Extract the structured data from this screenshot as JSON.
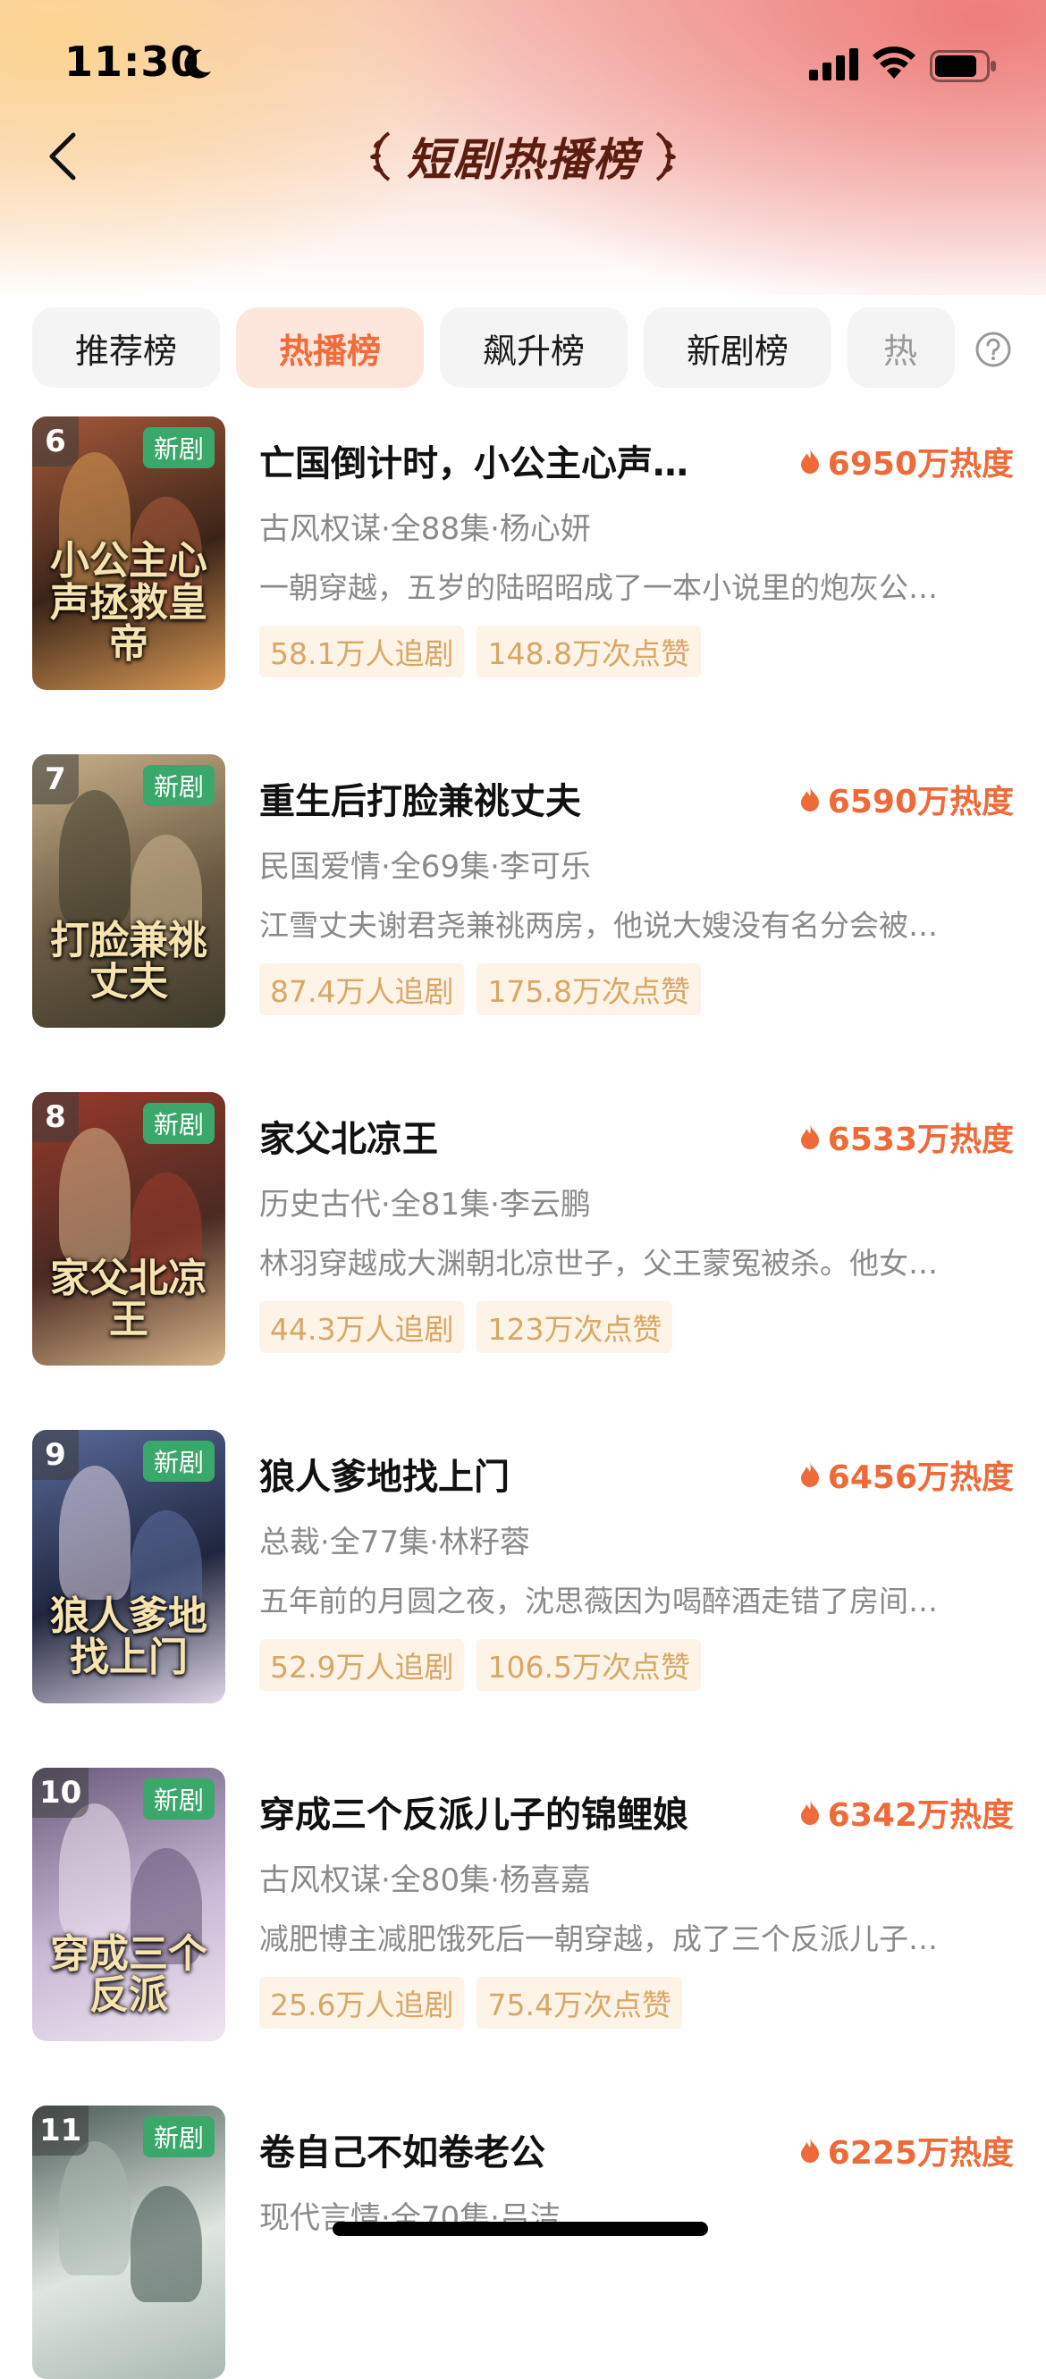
{
  "status": {
    "time": "11:30"
  },
  "header": {
    "title": "短剧热播榜"
  },
  "tabs": [
    {
      "label": "推荐榜",
      "active": false
    },
    {
      "label": "热播榜",
      "active": true
    },
    {
      "label": "飙升榜",
      "active": false
    },
    {
      "label": "新剧榜",
      "active": false
    },
    {
      "label": "热",
      "active": false
    }
  ],
  "items": [
    {
      "rank": "6",
      "tag": "新剧",
      "title": "亡国倒计时，小公主心声…",
      "heat": "6950万热度",
      "meta": "古风权谋·全88集·杨心妍",
      "desc": "一朝穿越，五岁的陆昭昭成了一本小说里的炮灰公…",
      "followers": "58.1万人追剧",
      "likes": "148.8万次点赞",
      "poster_text": "小公主心声拯救皇帝",
      "colors": [
        "#3a2418",
        "#a5593a",
        "#d99a55"
      ]
    },
    {
      "rank": "7",
      "tag": "新剧",
      "title": "重生后打脸兼祧丈夫",
      "heat": "6590万热度",
      "meta": "民国爱情·全69集·李可乐",
      "desc": "江雪丈夫谢君尧兼祧两房，他说大嫂没有名分会被…",
      "followers": "87.4万人追剧",
      "likes": "175.8万次点赞",
      "poster_text": "打脸兼祧丈夫",
      "colors": [
        "#6b5a43",
        "#c7b08a",
        "#3d3a2a"
      ]
    },
    {
      "rank": "8",
      "tag": "新剧",
      "title": "家父北凉王",
      "heat": "6533万热度",
      "meta": "历史古代·全81集·李云鹏",
      "desc": "林羽穿越成大渊朝北凉世子，父王蒙冤被杀。他女…",
      "followers": "44.3万人追剧",
      "likes": "123万次点赞",
      "poster_text": "家父北凉王",
      "colors": [
        "#4a2a22",
        "#9a3a2c",
        "#d8b58a"
      ]
    },
    {
      "rank": "9",
      "tag": "新剧",
      "title": "狼人爹地找上门",
      "heat": "6456万热度",
      "meta": "总裁·全77集·林籽蓉",
      "desc": "五年前的月圆之夜，沈思薇因为喝醉酒走错了房间…",
      "followers": "52.9万人追剧",
      "likes": "106.5万次点赞",
      "poster_text": "狼人爹地找上门",
      "colors": [
        "#20263e",
        "#5a6a9a",
        "#e0d6e8"
      ]
    },
    {
      "rank": "10",
      "tag": "新剧",
      "title": "穿成三个反派儿子的锦鲤娘",
      "heat": "6342万热度",
      "meta": "古风权谋·全80集·杨喜嘉",
      "desc": "减肥博主减肥饿死后一朝穿越，成了三个反派儿子…",
      "followers": "25.6万人追剧",
      "likes": "75.4万次点赞",
      "poster_text": "穿成三个反派",
      "colors": [
        "#c9b8d6",
        "#6a5a7a",
        "#f0e6f0"
      ]
    },
    {
      "rank": "11",
      "tag": "新剧",
      "title": "卷自己不如卷老公",
      "heat": "6225万热度",
      "meta": "现代言情·全70集·吕洁",
      "desc": "",
      "followers": "",
      "likes": "",
      "poster_text": "",
      "colors": [
        "#dfe6e0",
        "#4a5a55",
        "#a9b8b0"
      ]
    }
  ]
}
